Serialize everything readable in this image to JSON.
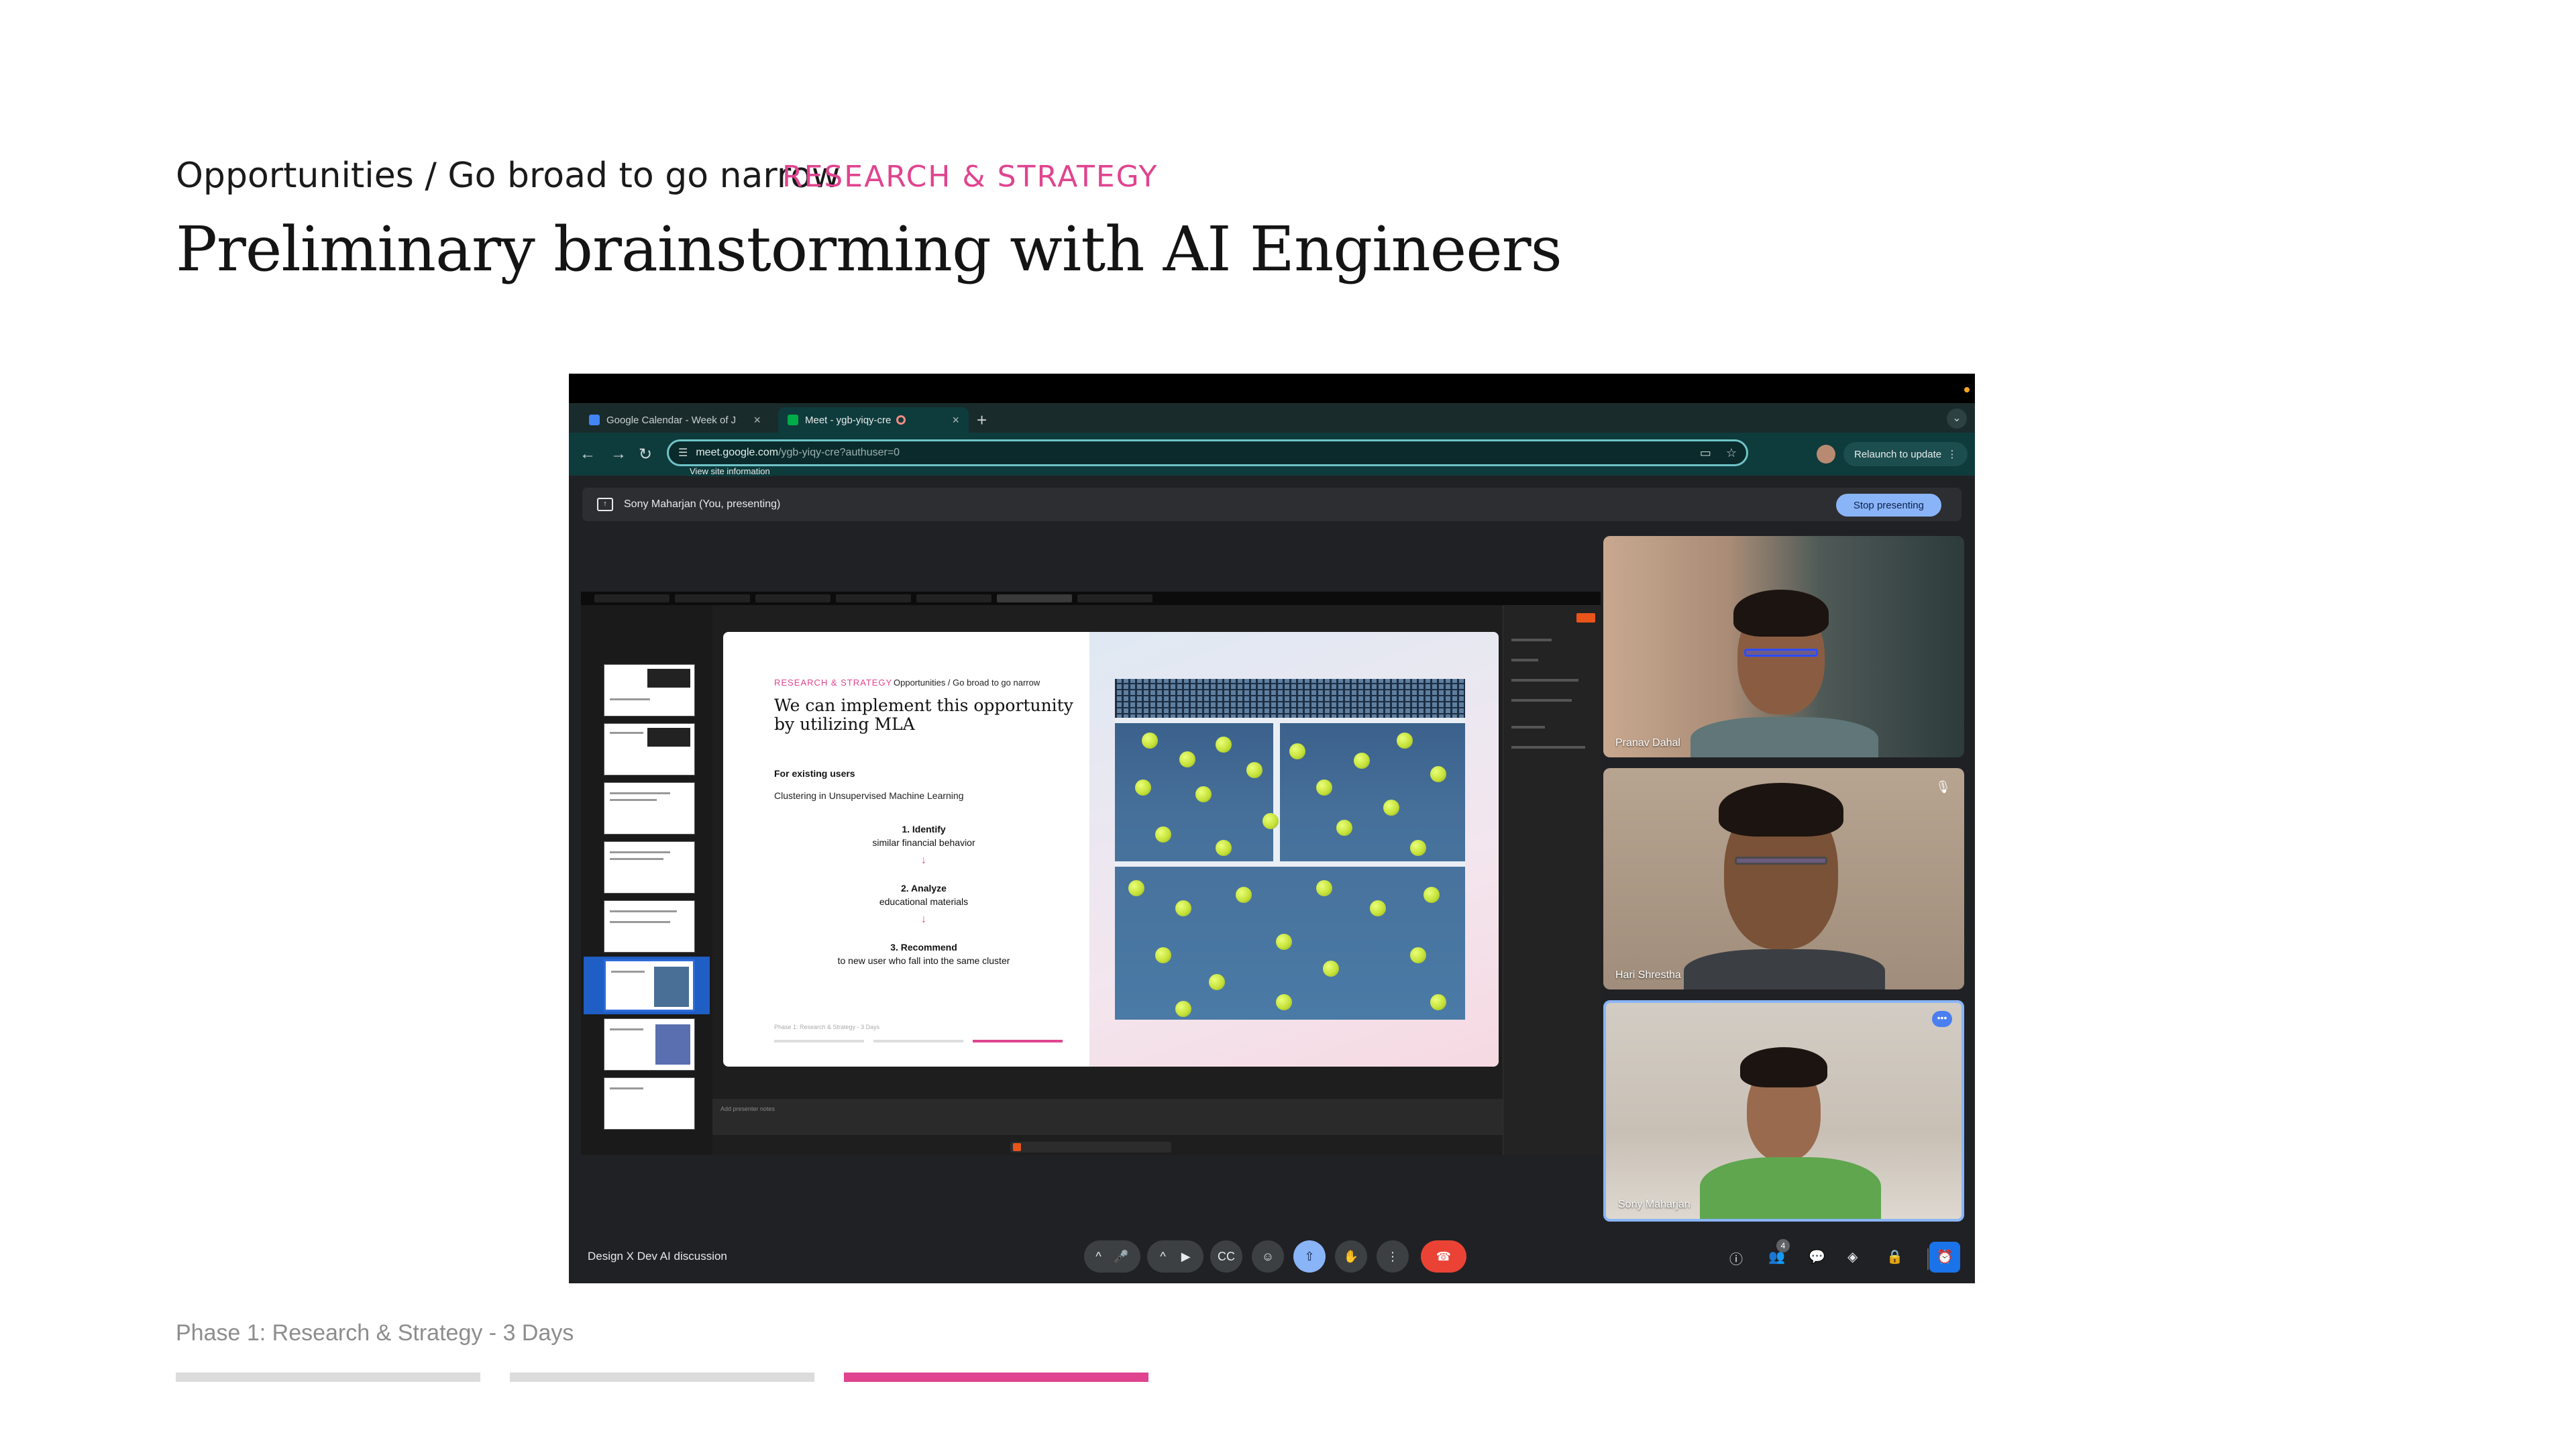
{
  "header": {
    "breadcrumb": "Opportunities / Go broad to go narrow",
    "tag": "RESEARCH & STRATEGY",
    "title": "Preliminary brainstorming with AI Engineers"
  },
  "footer": {
    "phase": "Phase 1: Research & Strategy -  3 Days",
    "progress_active_segment": 3,
    "progress_total_segments": 3,
    "accent_color": "#e0448f"
  },
  "browser": {
    "tabs": [
      {
        "label": "Google Calendar - Week of J",
        "icon": "calendar-icon",
        "active": false
      },
      {
        "label": "Meet - ygb-yiqy-cre",
        "icon": "meet-icon",
        "active": true
      }
    ],
    "url_host": "meet.google.com",
    "url_path": "/ygb-yiqy-cre?authuser=0",
    "site_info_tooltip": "View site information",
    "relaunch_label": "Relaunch to update",
    "theme_color": "#0e3b3c"
  },
  "meet": {
    "presenting_banner": "Sony Maharjan (You, presenting)",
    "stop_presenting_label": "Stop presenting",
    "meeting_name": "Design X Dev AI discussion",
    "participants": [
      {
        "name": "Pranav Dahal"
      },
      {
        "name": "Hari Shrestha",
        "muted": true
      },
      {
        "name": "Sony Maharjan",
        "active_speaker": true
      }
    ],
    "people_count": "4"
  },
  "presented_slide": {
    "tag": "RESEARCH & STRATEGY",
    "breadcrumb": "Opportunities / Go broad to go narrow",
    "title": "We can implement this opportunity by utilizing MLA",
    "subheading": "For existing users",
    "description": "Clustering in Unsupervised Machine Learning",
    "steps": [
      {
        "title": "1.  Identify",
        "detail": "similar financial behavior"
      },
      {
        "title": "2. Analyze",
        "detail": "educational materials"
      },
      {
        "title": "3. Recommend",
        "detail": "to new user who fall into the same cluster"
      }
    ],
    "arrow": "↓",
    "phase": "Phase 1: Research & Strategy - 3 Days",
    "notes_placeholder": "Add presenter notes"
  }
}
